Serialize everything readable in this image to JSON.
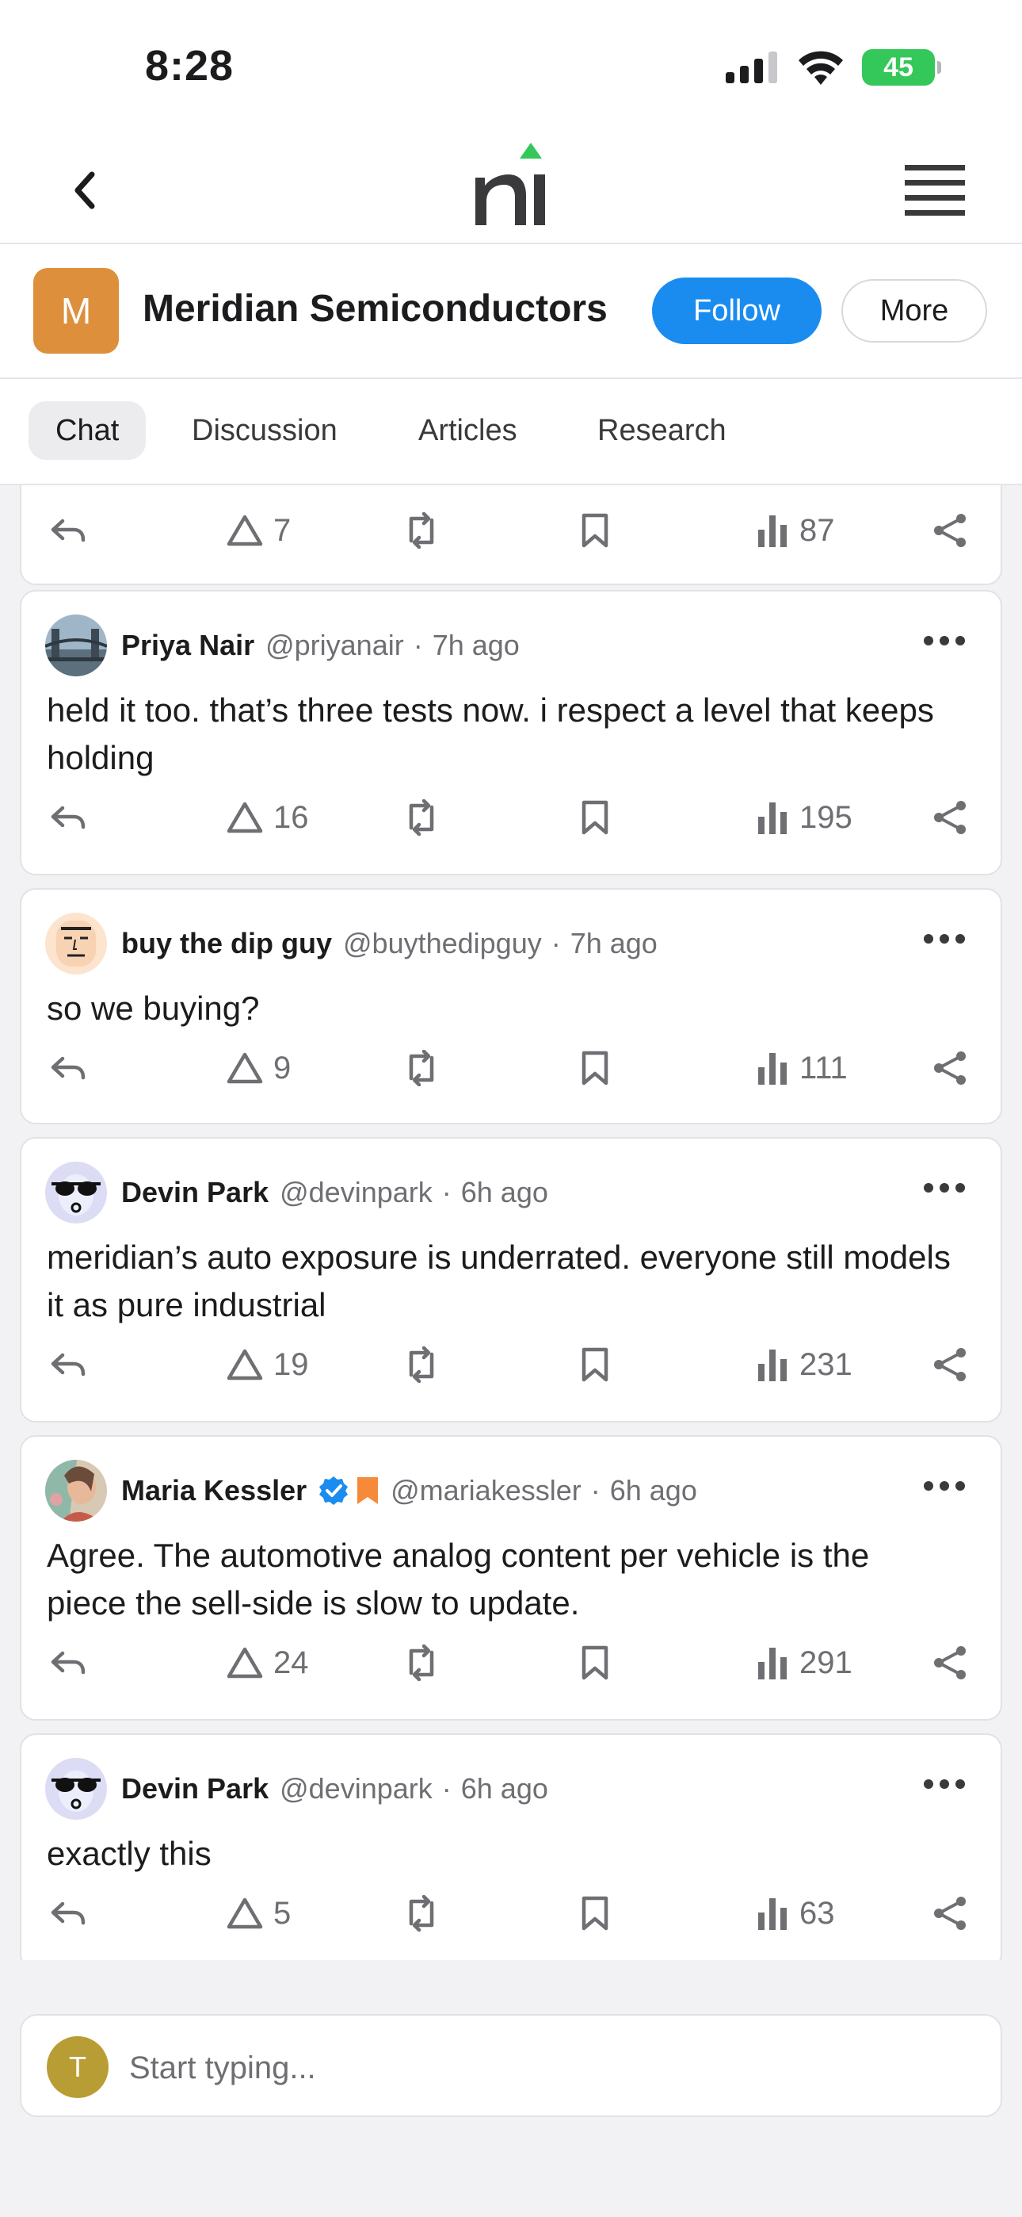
{
  "status_bar": {
    "time": "8:28",
    "battery": "45"
  },
  "nav": {
    "logo_text": "ni"
  },
  "company": {
    "avatar_letter": "M",
    "name": "Meridian Semiconductors",
    "follow_label": "Follow",
    "more_label": "More",
    "brand_color": "#dd8f3b"
  },
  "tabs": [
    {
      "label": "Chat",
      "active": true
    },
    {
      "label": "Discussion",
      "active": false
    },
    {
      "label": "Articles",
      "active": false
    },
    {
      "label": "Research",
      "active": false
    }
  ],
  "partial_post": {
    "likes": "7",
    "views": "87"
  },
  "posts": [
    {
      "name": "Priya Nair",
      "handle": "@priyanair",
      "time": "7h ago",
      "text": "held it too. that’s three tests now. i respect a level that keeps holding",
      "likes": "16",
      "views": "195",
      "avatar": "bridge-photo-avatar"
    },
    {
      "name": "buy the dip guy",
      "handle": "@buythedipguy",
      "time": "7h ago",
      "text": "so we buying?",
      "likes": "9",
      "views": "111",
      "avatar": "cartoon-face-avatar"
    },
    {
      "name": "Devin Park",
      "handle": "@devinpark",
      "time": "6h ago",
      "text": "meridian’s auto exposure is underrated. everyone still models it as pure industrial",
      "likes": "19",
      "views": "231",
      "avatar": "sunglasses-avatar"
    },
    {
      "name": "Maria Kessler",
      "handle": "@mariakessler",
      "time": "6h ago",
      "text": "Agree. The automotive analog content per vehicle is the piece the sell-side is slow to update.",
      "likes": "24",
      "views": "291",
      "avatar": "painted-portrait-avatar",
      "badges": [
        "verified-badge-icon",
        "bookmark-badge-icon"
      ]
    },
    {
      "name": "Devin Park",
      "handle": "@devinpark",
      "time": "6h ago",
      "text": "exactly this",
      "likes": "5",
      "views": "63",
      "avatar": "sunglasses-avatar"
    }
  ],
  "composer": {
    "avatar_letter": "T",
    "placeholder": "Start typing..."
  },
  "colors": {
    "accent": "#1a8cf0",
    "logo_arrow": "#34c759",
    "battery": "#34c759"
  }
}
